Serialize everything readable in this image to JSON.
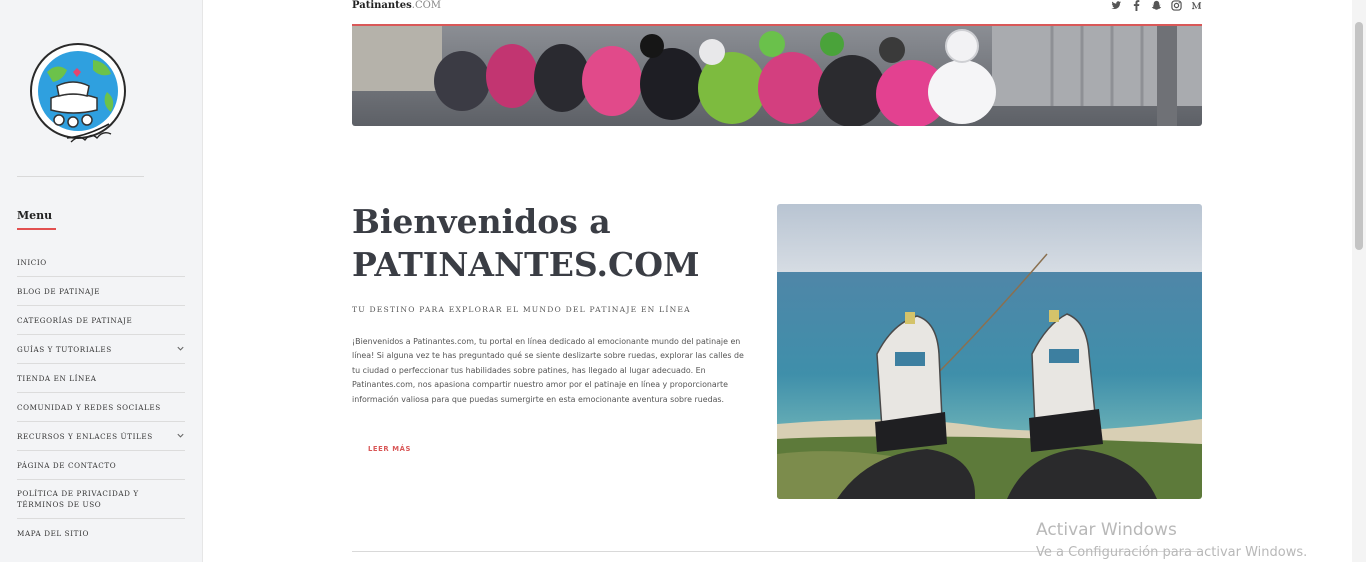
{
  "site": {
    "name_bold": "Patinantes",
    "name_rest": ".COM"
  },
  "social": [
    {
      "icon": "twitter-icon"
    },
    {
      "icon": "facebook-icon"
    },
    {
      "icon": "snapchat-icon"
    },
    {
      "icon": "instagram-icon"
    },
    {
      "icon": "medium-icon"
    }
  ],
  "sidebar": {
    "menu_title": "Menu",
    "items": [
      {
        "label": "Inicio"
      },
      {
        "label": "Blog de Patinaje"
      },
      {
        "label": "Categorías de Patinaje"
      },
      {
        "label": "Guías y Tutoriales",
        "has_submenu": true
      },
      {
        "label": "Tienda en Línea"
      },
      {
        "label": "Comunidad y Redes Sociales"
      },
      {
        "label": "Recursos y Enlaces Útiles",
        "has_submenu": true
      },
      {
        "label": "Página de Contacto"
      },
      {
        "label": "Política de Privacidad y Términos de Uso"
      },
      {
        "label": "Mapa del Sitio"
      }
    ]
  },
  "main": {
    "heading_line1": "Bienvenidos a",
    "heading_line2": "PATINANTES.COM",
    "tagline": "Tu destino para explorar el mundo del patinaje en línea",
    "intro": "¡Bienvenidos a Patinantes.com, tu portal en línea dedicado al emocionante mundo del patinaje en línea! Si alguna vez te has preguntado qué se siente deslizarte sobre ruedas, explorar las calles de tu ciudad o perfeccionar tus habilidades sobre patines, has llegado al lugar adecuado. En Patinantes.com, nos apasiona compartir nuestro amor por el patinaje en línea y proporcionarte información valiosa para que puedas sumergirte en esta emocionante aventura sobre ruedas.",
    "read_more": "Leer más"
  },
  "watermark": {
    "title": "Activar Windows",
    "subtitle": "Ve a Configuración para activar Windows."
  },
  "colors": {
    "accent": "#d95858",
    "sidebar_bg": "#f3f4f6",
    "heading": "#3a3d44"
  }
}
